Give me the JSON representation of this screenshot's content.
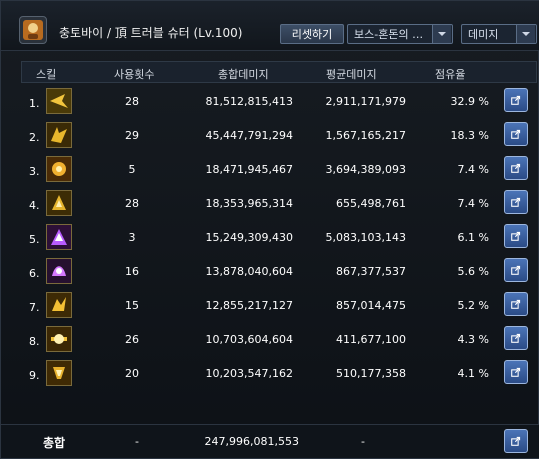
{
  "header": {
    "title": "충토바이 / 頂 트러블 슈터 (Lv.100)",
    "reset_label": "리셋하기",
    "boss_select": "보스-혼돈의 오...",
    "metric_select": "데미지"
  },
  "columns": [
    "스킬",
    "사용횟수",
    "총합데미지",
    "평균데미지",
    "점유율"
  ],
  "rows": [
    {
      "rank": "1.",
      "uses": "28",
      "total": "81,512,815,413",
      "avg": "2,911,171,979",
      "share": "32.9 %"
    },
    {
      "rank": "2.",
      "uses": "29",
      "total": "45,447,791,294",
      "avg": "1,567,165,217",
      "share": "18.3 %"
    },
    {
      "rank": "3.",
      "uses": "5",
      "total": "18,471,945,467",
      "avg": "3,694,389,093",
      "share": "7.4 %"
    },
    {
      "rank": "4.",
      "uses": "28",
      "total": "18,353,965,314",
      "avg": "655,498,761",
      "share": "7.4 %"
    },
    {
      "rank": "5.",
      "uses": "3",
      "total": "15,249,309,430",
      "avg": "5,083,103,143",
      "share": "6.1 %"
    },
    {
      "rank": "6.",
      "uses": "16",
      "total": "13,878,040,604",
      "avg": "867,377,537",
      "share": "5.6 %"
    },
    {
      "rank": "7.",
      "uses": "15",
      "total": "12,855,217,127",
      "avg": "857,014,475",
      "share": "5.2 %"
    },
    {
      "rank": "8.",
      "uses": "26",
      "total": "10,703,604,604",
      "avg": "411,677,100",
      "share": "4.3 %"
    },
    {
      "rank": "9.",
      "uses": "20",
      "total": "10,203,547,162",
      "avg": "510,177,358",
      "share": "4.1 %"
    }
  ],
  "footer": {
    "label": "총합",
    "uses": "-",
    "total": "247,996,081,553",
    "avg": "-"
  },
  "colors": {
    "accent": "#4b74b7",
    "border": "#2b3440",
    "text": "#ffffff"
  },
  "icons": {
    "avatar": "character-avatar",
    "dropdown": "chevron-down-icon",
    "export": "export-icon",
    "skill": "skill-icon"
  }
}
